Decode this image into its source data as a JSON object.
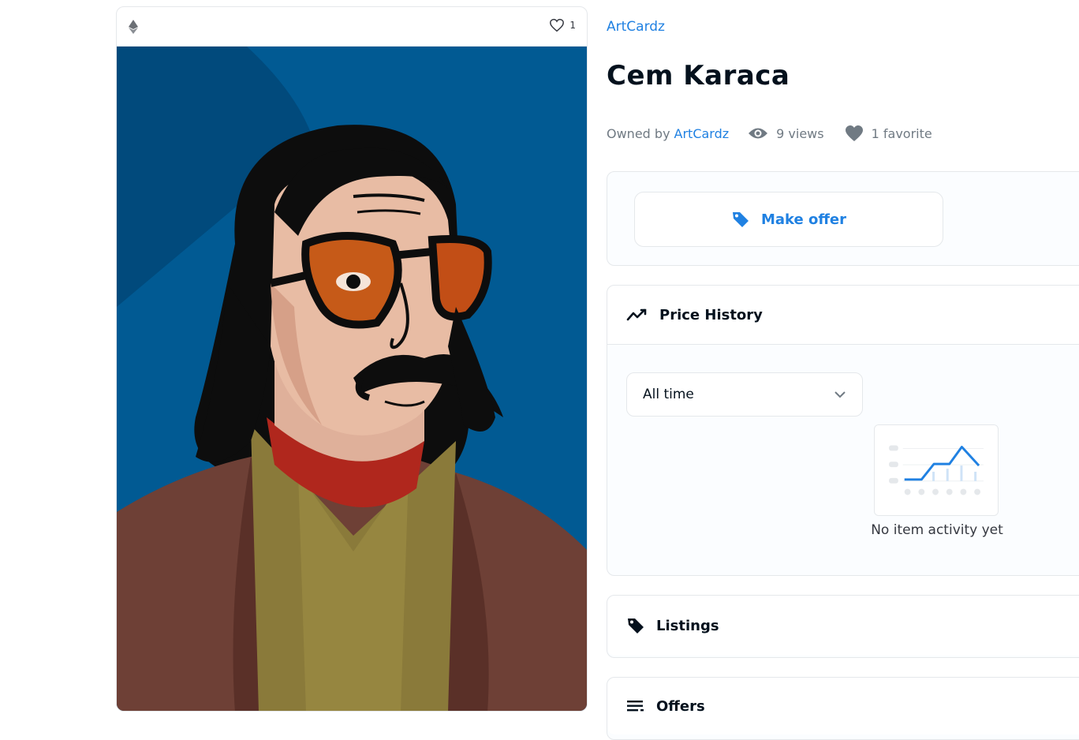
{
  "card": {
    "favorite_count": "1",
    "icons": {
      "chain": "ethereum-icon",
      "favorite": "heart-outline-icon"
    },
    "artwork": {
      "subject": "illustrated portrait",
      "background_color": "#015a93"
    }
  },
  "item": {
    "collection": "ArtCardz",
    "title": "Cem Karaca",
    "owned_by_prefix": "Owned by",
    "owner": "ArtCardz",
    "views": "9 views",
    "favorites": "1 favorite"
  },
  "actions": {
    "make_offer": "Make offer"
  },
  "price_history": {
    "title": "Price History",
    "filter_selected": "All time",
    "empty_message": "No item activity yet"
  },
  "sections": {
    "listings": "Listings",
    "offers": "Offers"
  },
  "colors": {
    "accent": "#2081e2",
    "text": "#04111d",
    "muted": "#707a83",
    "border": "#e5e8eb"
  }
}
